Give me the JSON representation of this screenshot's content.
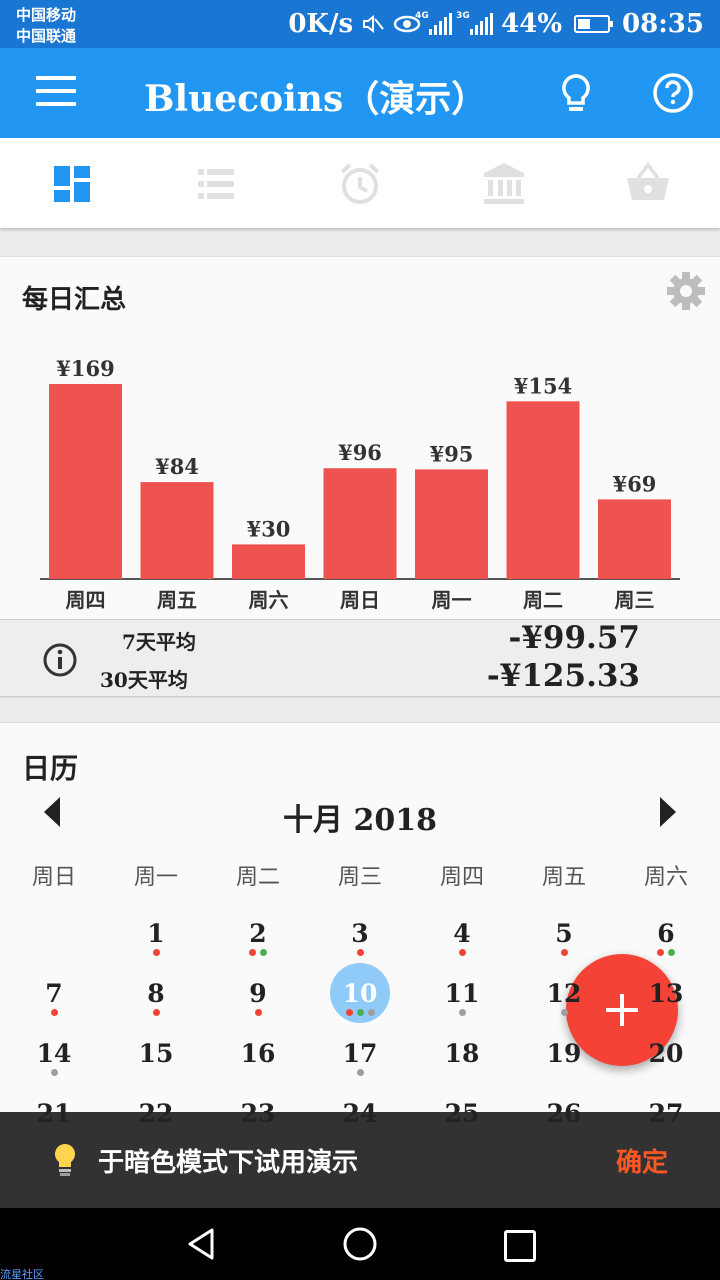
{
  "status_bar": {
    "carrier1": "中国移动",
    "carrier2": "中国联通",
    "speed": "0K/s",
    "net1": "4G",
    "net2": "3G",
    "battery": "44%",
    "battery_level": 0.44,
    "time": "08:35"
  },
  "app_bar": {
    "title": "Bluecoins（演示）"
  },
  "tabs": [
    {
      "icon": "dashboard-icon",
      "active": true
    },
    {
      "icon": "list-icon",
      "active": false
    },
    {
      "icon": "alarm-clock-icon",
      "active": false
    },
    {
      "icon": "bank-icon",
      "active": false
    },
    {
      "icon": "basket-icon",
      "active": false
    }
  ],
  "daily_summary": {
    "title": "每日汇总",
    "avg7_label": "7天平均",
    "avg7_value": "-¥99.57",
    "avg30_label": "30天平均",
    "avg30_value": "-¥125.33"
  },
  "chart_data": {
    "type": "bar",
    "categories": [
      "周四",
      "周五",
      "周六",
      "周日",
      "周一",
      "周二",
      "周三"
    ],
    "values": [
      169,
      84,
      30,
      96,
      95,
      154,
      69
    ],
    "labels": [
      "¥169",
      "¥84",
      "¥30",
      "¥96",
      "¥95",
      "¥154",
      "¥69"
    ],
    "color": "#ef5350"
  },
  "calendar": {
    "title": "日历",
    "month": "十月  2018",
    "weekdays": [
      "周日",
      "周一",
      "周二",
      "周三",
      "周四",
      "周五",
      "周六"
    ],
    "today": "10",
    "rows": [
      [
        {
          "d": ""
        },
        {
          "d": "1",
          "dots": [
            "red"
          ]
        },
        {
          "d": "2",
          "dots": [
            "red",
            "green"
          ]
        },
        {
          "d": "3",
          "dots": [
            "red"
          ]
        },
        {
          "d": "4",
          "dots": [
            "red"
          ]
        },
        {
          "d": "5",
          "dots": [
            "red"
          ]
        },
        {
          "d": "6",
          "dots": [
            "red",
            "green"
          ]
        }
      ],
      [
        {
          "d": "7",
          "dots": [
            "red"
          ]
        },
        {
          "d": "8",
          "dots": [
            "red"
          ]
        },
        {
          "d": "9",
          "dots": [
            "red"
          ]
        },
        {
          "d": "10",
          "dots": [
            "red",
            "green",
            "gray"
          ]
        },
        {
          "d": "11",
          "dots": [
            "gray"
          ]
        },
        {
          "d": "12",
          "dots": [
            "gray"
          ]
        },
        {
          "d": "13"
        }
      ],
      [
        {
          "d": "14",
          "dots": [
            "gray"
          ]
        },
        {
          "d": "15"
        },
        {
          "d": "16"
        },
        {
          "d": "17",
          "dots": [
            "gray"
          ]
        },
        {
          "d": "18"
        },
        {
          "d": "19"
        },
        {
          "d": "20"
        }
      ],
      [
        {
          "d": "21"
        },
        {
          "d": "22"
        },
        {
          "d": "23"
        },
        {
          "d": "24"
        },
        {
          "d": "25"
        },
        {
          "d": "26"
        },
        {
          "d": "27"
        }
      ]
    ],
    "dot_colors": {
      "red": "#f44336",
      "green": "#4caf50",
      "gray": "#9e9e9e"
    }
  },
  "fab": {
    "label": "+"
  },
  "snackbar": {
    "icon": "lightbulb-icon",
    "text": "于暗色模式下试用演示",
    "action": "确定"
  },
  "watermark": "流星社区"
}
